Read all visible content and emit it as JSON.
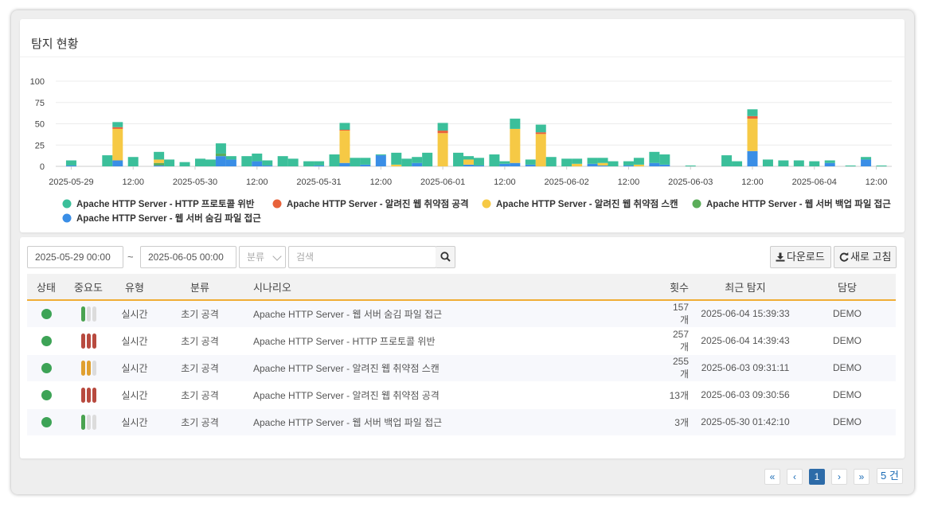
{
  "panel_title": "탐지 현황",
  "colors": {
    "http_protocol": "#3bbf9a",
    "web_attack": "#e8623a",
    "web_scan": "#f6c945",
    "backup": "#5bad5a",
    "hidden": "#3a8ee6",
    "accent": "#f0ad36",
    "status_ok": "#3da356",
    "imp_high": "#b84a3f",
    "imp_mid": "#e0a030",
    "imp_low": "#4aa350"
  },
  "chart_data": {
    "type": "bar",
    "stacked": true,
    "ylim": [
      0,
      100
    ],
    "yticks": [
      0,
      25,
      50,
      75,
      100
    ],
    "grid": true,
    "legend_position": "bottom",
    "xtick_labels": [
      "2025-05-29",
      "12:00",
      "2025-05-30",
      "12:00",
      "2025-05-31",
      "12:00",
      "2025-06-01",
      "12:00",
      "2025-06-02",
      "12:00",
      "2025-06-03",
      "12:00",
      "2025-06-04",
      "12:00"
    ],
    "xticks_hours": [
      0,
      12,
      24,
      36,
      48,
      60,
      72,
      84,
      96,
      108,
      120,
      132,
      144,
      156
    ],
    "bar_hours": [
      0,
      3,
      7,
      9,
      12,
      15,
      17,
      19,
      22,
      25,
      27,
      29,
      31,
      34,
      36,
      38,
      41,
      43,
      46,
      48,
      51,
      53,
      55,
      57,
      60,
      63,
      65,
      67,
      69,
      72,
      75,
      77,
      79,
      82,
      84,
      86,
      89,
      91,
      93,
      96,
      98,
      101,
      103,
      105,
      108,
      110,
      113,
      115,
      120,
      127,
      129,
      132,
      135,
      138,
      141,
      144,
      147,
      151,
      154,
      157
    ],
    "series": [
      {
        "name": "Apache HTTP Server - HTTP 프로토콜 위반",
        "key": "http_protocol",
        "values": [
          6,
          0,
          13,
          6,
          11,
          0,
          9,
          8,
          5,
          9,
          8,
          12,
          4,
          12,
          9,
          6,
          12,
          9,
          6,
          5,
          14,
          8,
          10,
          8,
          1,
          14,
          9,
          7,
          16,
          9,
          16,
          4,
          9,
          14,
          3,
          12,
          6,
          9,
          11,
          9,
          6,
          7,
          6,
          6,
          5,
          8,
          13,
          12,
          1,
          13,
          6,
          8,
          8,
          7,
          7,
          6,
          3,
          1,
          3,
          1
        ]
      },
      {
        "name": "Apache HTTP Server - 알려진 웹 취약점 공격",
        "key": "web_attack",
        "values": [
          0,
          0,
          0,
          2,
          0,
          0,
          0,
          0,
          0,
          0,
          0,
          0,
          0,
          0,
          0,
          0,
          0,
          0,
          0,
          0,
          0,
          1,
          0,
          0,
          0,
          0,
          0,
          0,
          0,
          3,
          0,
          0,
          0,
          0,
          0,
          0,
          0,
          2,
          0,
          0,
          0,
          0,
          0,
          0,
          0,
          0,
          0,
          0,
          0,
          0,
          0,
          3,
          0,
          0,
          0,
          0,
          0,
          0,
          0,
          0
        ]
      },
      {
        "name": "Apache HTTP Server - 알려진 웹 취약점 스캔",
        "key": "web_scan",
        "values": [
          0,
          0,
          0,
          37,
          0,
          0,
          4,
          0,
          0,
          0,
          0,
          0,
          0,
          0,
          0,
          0,
          0,
          0,
          0,
          0,
          0,
          38,
          0,
          0,
          0,
          2,
          0,
          0,
          0,
          39,
          0,
          6,
          0,
          0,
          0,
          40,
          0,
          38,
          0,
          0,
          3,
          0,
          3,
          0,
          0,
          2,
          0,
          0,
          0,
          0,
          0,
          38,
          0,
          0,
          0,
          0,
          0,
          0,
          0,
          0
        ]
      },
      {
        "name": "Apache HTTP Server - 웹 서버 백업 파일 접근",
        "key": "backup",
        "values": [
          0,
          0,
          0,
          0,
          0,
          0,
          3,
          0,
          0,
          0,
          0,
          3,
          0,
          0,
          0,
          0,
          0,
          0,
          0,
          0,
          0,
          0,
          0,
          0,
          0,
          0,
          0,
          0,
          0,
          0,
          0,
          0,
          0,
          0,
          0,
          0,
          0,
          0,
          0,
          0,
          0,
          0,
          0,
          0,
          0,
          0,
          0,
          0,
          0,
          0,
          0,
          0,
          0,
          0,
          0,
          0,
          0,
          0,
          0,
          0
        ]
      },
      {
        "name": "Apache HTTP Server - 웹 서버 숨김 파일 접근",
        "key": "hidden",
        "values": [
          1,
          0,
          0,
          7,
          0,
          0,
          1,
          0,
          0,
          0,
          0,
          12,
          8,
          0,
          6,
          1,
          0,
          0,
          0,
          1,
          0,
          4,
          0,
          2,
          13,
          0,
          0,
          4,
          0,
          0,
          0,
          2,
          1,
          0,
          3,
          4,
          2,
          0,
          0,
          0,
          0,
          3,
          1,
          0,
          1,
          0,
          4,
          2,
          0,
          0,
          0,
          18,
          0,
          0,
          0,
          0,
          4,
          0,
          8,
          0
        ]
      }
    ]
  },
  "filters": {
    "start": "2025-05-29 00:00",
    "tilde": "~",
    "end": "2025-06-05 00:00",
    "category_placeholder": "분류",
    "search_placeholder": "검색"
  },
  "buttons": {
    "download": "다운로드",
    "refresh": "새로 고침"
  },
  "table": {
    "headers": [
      "상태",
      "중요도",
      "유형",
      "분류",
      "시나리오",
      "횟수",
      "최근 탐지",
      "담당"
    ],
    "rows": [
      {
        "importance": "low",
        "type": "실시간",
        "category": "초기 공격",
        "scenario": "Apache HTTP Server - 웹 서버 숨김 파일 접근",
        "count": "157개",
        "last": "2025-06-04 15:39:33",
        "owner": "DEMO"
      },
      {
        "importance": "high",
        "type": "실시간",
        "category": "초기 공격",
        "scenario": "Apache HTTP Server - HTTP 프로토콜 위반",
        "count": "257개",
        "last": "2025-06-04 14:39:43",
        "owner": "DEMO"
      },
      {
        "importance": "mid",
        "type": "실시간",
        "category": "초기 공격",
        "scenario": "Apache HTTP Server - 알려진 웹 취약점 스캔",
        "count": "255개",
        "last": "2025-06-03 09:31:11",
        "owner": "DEMO"
      },
      {
        "importance": "high",
        "type": "실시간",
        "category": "초기 공격",
        "scenario": "Apache HTTP Server - 알려진 웹 취약점 공격",
        "count": "13개",
        "last": "2025-06-03 09:30:56",
        "owner": "DEMO"
      },
      {
        "importance": "low",
        "type": "실시간",
        "category": "초기 공격",
        "scenario": "Apache HTTP Server - 웹 서버 백업 파일 접근",
        "count": "3개",
        "last": "2025-05-30 01:42:10",
        "owner": "DEMO"
      }
    ]
  },
  "pagination": {
    "first": "«",
    "prev": "‹",
    "current": "1",
    "next": "›",
    "last": "»",
    "total": "5 건"
  }
}
